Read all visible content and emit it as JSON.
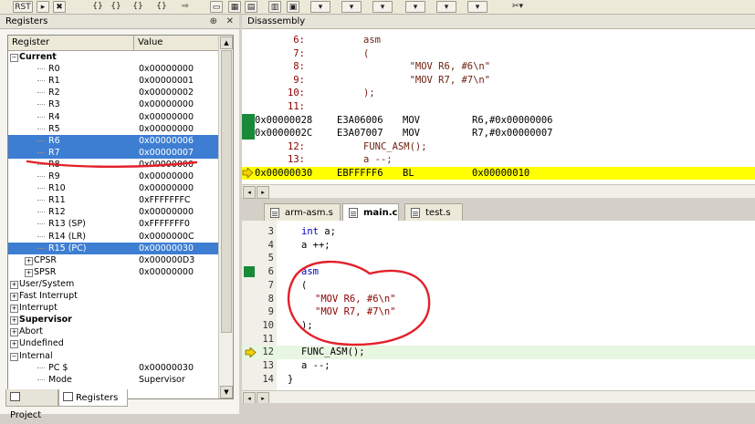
{
  "toolbar": {
    "rst_label": "RST",
    "buttons": [
      "reset-icon",
      "run-icon",
      "stop-icon",
      "step-into-icon",
      "step-over-icon",
      "step-out-icon",
      "run-to-cursor-icon",
      "show-next-icon",
      "command-window-icon",
      "disassembly-window-icon",
      "symbols-window-icon",
      "registers-window-icon",
      "call-stack-icon",
      "watch-window-icon",
      "memory-window-icon",
      "serial-window-icon",
      "analysis-window-icon",
      "trace-window-icon",
      "system-viewer-icon",
      "toolbox-icon"
    ]
  },
  "registers": {
    "title": "Registers",
    "pin_glyph": "⊕",
    "close_glyph": "✕",
    "columns": [
      "Register",
      "Value"
    ],
    "rows": [
      {
        "name": "Current",
        "value": "",
        "level": 0,
        "expander": "−",
        "bold": true,
        "selected": false
      },
      {
        "name": "R0",
        "value": "0x00000000",
        "level": 2,
        "selected": false
      },
      {
        "name": "R1",
        "value": "0x00000001",
        "level": 2,
        "selected": false
      },
      {
        "name": "R2",
        "value": "0x00000002",
        "level": 2,
        "selected": false
      },
      {
        "name": "R3",
        "value": "0x00000000",
        "level": 2,
        "selected": false
      },
      {
        "name": "R4",
        "value": "0x00000000",
        "level": 2,
        "selected": false
      },
      {
        "name": "R5",
        "value": "0x00000000",
        "level": 2,
        "selected": false
      },
      {
        "name": "R6",
        "value": "0x00000006",
        "level": 2,
        "selected": true
      },
      {
        "name": "R7",
        "value": "0x00000007",
        "level": 2,
        "selected": true
      },
      {
        "name": "R8",
        "value": "0x00000000",
        "level": 2,
        "selected": false
      },
      {
        "name": "R9",
        "value": "0x00000000",
        "level": 2,
        "selected": false
      },
      {
        "name": "R10",
        "value": "0x00000000",
        "level": 2,
        "selected": false
      },
      {
        "name": "R11",
        "value": "0xFFFFFFFC",
        "level": 2,
        "selected": false
      },
      {
        "name": "R12",
        "value": "0x00000000",
        "level": 2,
        "selected": false
      },
      {
        "name": "R13 (SP)",
        "value": "0xFFFFFFF0",
        "level": 2,
        "selected": false
      },
      {
        "name": "R14 (LR)",
        "value": "0x0000000C",
        "level": 2,
        "selected": false
      },
      {
        "name": "R15 (PC)",
        "value": "0x00000030",
        "level": 2,
        "selected": true
      },
      {
        "name": "CPSR",
        "value": "0x000000D3",
        "level": 1,
        "expander": "+",
        "selected": false
      },
      {
        "name": "SPSR",
        "value": "0x00000000",
        "level": 1,
        "expander": "+",
        "selected": false
      },
      {
        "name": "User/System",
        "value": "",
        "level": 0,
        "expander": "+",
        "selected": false
      },
      {
        "name": "Fast Interrupt",
        "value": "",
        "level": 0,
        "expander": "+",
        "selected": false
      },
      {
        "name": "Interrupt",
        "value": "",
        "level": 0,
        "expander": "+",
        "selected": false
      },
      {
        "name": "Supervisor",
        "value": "",
        "level": 0,
        "expander": "+",
        "bold": true,
        "selected": false
      },
      {
        "name": "Abort",
        "value": "",
        "level": 0,
        "expander": "+",
        "selected": false
      },
      {
        "name": "Undefined",
        "value": "",
        "level": 0,
        "expander": "+",
        "selected": false
      },
      {
        "name": "Internal",
        "value": "",
        "level": 0,
        "expander": "−",
        "selected": false
      },
      {
        "name": "PC  $",
        "value": "0x00000030",
        "level": 2,
        "selected": false
      },
      {
        "name": "Mode",
        "value": "Supervisor",
        "level": 2,
        "selected": false
      }
    ],
    "tabs": [
      {
        "label": "Project",
        "active": false
      },
      {
        "label": "Registers",
        "active": true
      }
    ]
  },
  "disassembly": {
    "title": "Disassembly",
    "lines": [
      {
        "type": "src",
        "num": "6:",
        "text": "asm"
      },
      {
        "type": "src",
        "num": "7:",
        "text": "("
      },
      {
        "type": "src",
        "num": "8:",
        "text": "        \"MOV R6, #6\\n\""
      },
      {
        "type": "src",
        "num": "9:",
        "text": "        \"MOV R7, #7\\n\""
      },
      {
        "type": "src",
        "num": "10:",
        "text": ");"
      },
      {
        "type": "src",
        "num": "11:",
        "text": ""
      },
      {
        "type": "asm",
        "addr": "0x00000028",
        "opcode": "E3A06006",
        "mnemonic": "MOV",
        "operands": "R6,#0x00000006",
        "exec": true
      },
      {
        "type": "asm",
        "addr": "0x0000002C",
        "opcode": "E3A07007",
        "mnemonic": "MOV",
        "operands": "R7,#0x00000007",
        "exec": true
      },
      {
        "type": "src",
        "num": "12:",
        "text": "FUNC_ASM();"
      },
      {
        "type": "src",
        "num": "13:",
        "text": "a --;"
      },
      {
        "type": "asm",
        "addr": "0x00000030",
        "opcode": "EBFFFFF6",
        "mnemonic": "BL",
        "operands": "0x00000010",
        "current": true
      }
    ]
  },
  "editor": {
    "tabs": [
      {
        "label": "arm-asm.s",
        "active": false
      },
      {
        "label": "main.c",
        "active": true
      },
      {
        "label": "test.s",
        "active": false
      }
    ],
    "lines": [
      {
        "num": "3",
        "code": "int a;",
        "kw": "int",
        "indent": 0
      },
      {
        "num": "4",
        "code": "a ++;",
        "indent": 0
      },
      {
        "num": "5",
        "code": "",
        "indent": 0
      },
      {
        "num": "6",
        "code": "asm",
        "kwonly": true,
        "exec": true,
        "indent": 0
      },
      {
        "num": "7",
        "code": "(",
        "indent": 0
      },
      {
        "num": "8",
        "code": "\"MOV R6, #6\\n\"",
        "str": true,
        "indent": 1
      },
      {
        "num": "9",
        "code": "\"MOV R7, #7\\n\"",
        "str": true,
        "indent": 1
      },
      {
        "num": "10",
        "code": ");",
        "indent": 0
      },
      {
        "num": "11",
        "code": "",
        "indent": 0
      },
      {
        "num": "12",
        "code": "FUNC_ASM();",
        "current": true,
        "indent": 0
      },
      {
        "num": "13",
        "code": "a --;",
        "indent": 0
      },
      {
        "num": "14",
        "code": "}",
        "close": true,
        "indent": -1
      }
    ]
  },
  "colors": {
    "selection": "#3d7ed2",
    "current_line": "#ffff00",
    "exec_marker": "#188a3a",
    "annotation_red": "#e3202a",
    "arrow_yellow": "#f5d000"
  }
}
